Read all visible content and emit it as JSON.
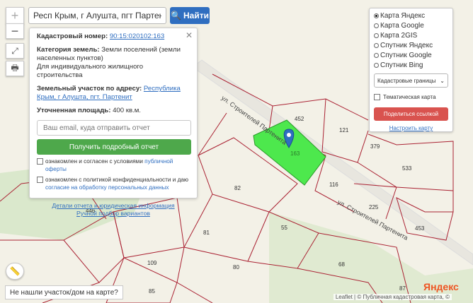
{
  "search": {
    "value": "Респ Крым, г Алушта, пгт Партенит, ул С",
    "button": "Найти"
  },
  "zoom": {
    "in": "+",
    "out": "−"
  },
  "info": {
    "cadastral_label": "Кадастровый номер:",
    "cadastral_value": "90:15:020102:163",
    "category_label": "Категория земель:",
    "category_value": "Земли поселений (земли населенных пунктов)",
    "use": "Для индивидуального жилищного строительства",
    "address_label": "Земельный участок по адресу:",
    "address_value": "Республика Крым, г Алушта, пгт. Партенит",
    "area_label": "Уточненная площадь:",
    "area_value": "400 кв.м.",
    "email_placeholder": "Ваш email, куда отправить отчет",
    "report_button": "Получить подробный отчет",
    "agree1_text": "ознакомлен и согласен с условиями",
    "agree1_link": "публичной оферты",
    "agree2_text": "ознакомлен с политикой конфиденциальности и даю",
    "agree2_link": "согласие на обработку персональных данных",
    "details_link": "Детали отчета и юридическая информация",
    "manual_link": "Ручной подбор вариантов"
  },
  "layers": {
    "options": [
      "Карта Яндекс",
      "Карта Google",
      "Карта 2GIS",
      "Спутник Яндекс",
      "Спутник Google",
      "Спутник Bing"
    ],
    "selected": 0,
    "select_value": "Кадастровые границы",
    "thematic": "Тематическая карта",
    "share_button": "Поделиться ссылкой",
    "configure_link": "Настроить карту"
  },
  "map": {
    "street1": "ул. Строителей Партенита",
    "street2": "ул. Строителей Партенита",
    "parcel_selected": "163",
    "parcels": [
      "452",
      "121",
      "379",
      "533",
      "116",
      "225",
      "453",
      "82",
      "446",
      "81",
      "55",
      "109",
      "80",
      "68",
      "85",
      "87"
    ]
  },
  "hint": "Не нашли участок/дом на карте?",
  "attribution": "Leaflet | © Публичная кадастровая карта, ©",
  "logo": "Яндекс"
}
